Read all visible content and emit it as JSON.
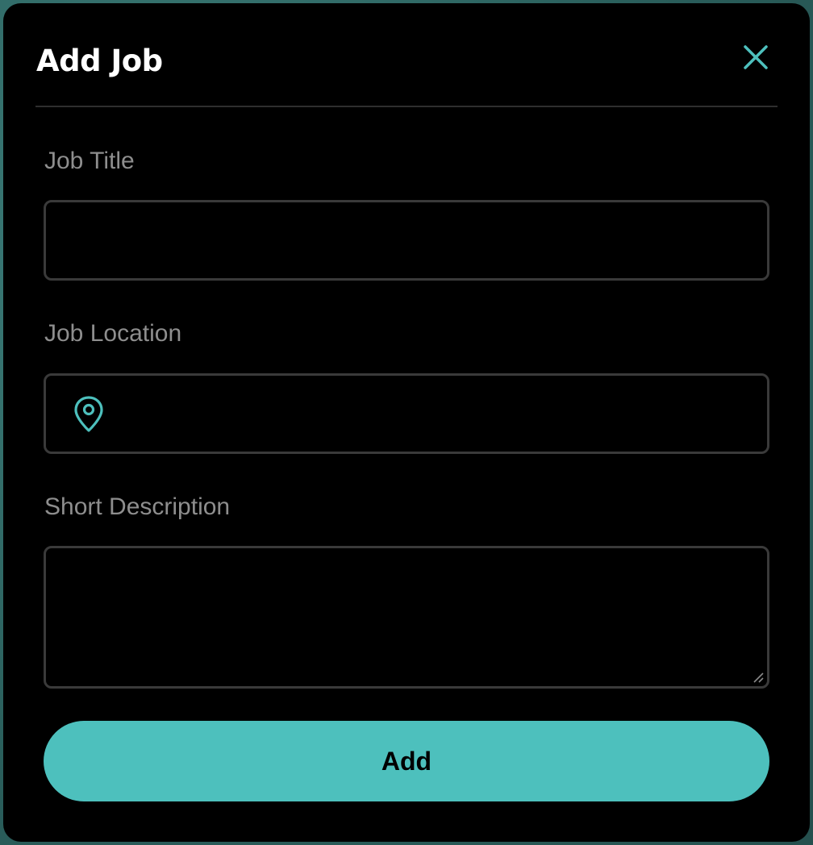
{
  "modal": {
    "title": "Add Job",
    "close_icon": "close-icon",
    "accent_color": "#4dc0bd"
  },
  "form": {
    "job_title": {
      "label": "Job Title",
      "value": ""
    },
    "job_location": {
      "label": "Job Location",
      "value": "",
      "icon": "location-pin-icon"
    },
    "short_description": {
      "label": "Short Description",
      "value": ""
    },
    "submit_label": "Add"
  }
}
